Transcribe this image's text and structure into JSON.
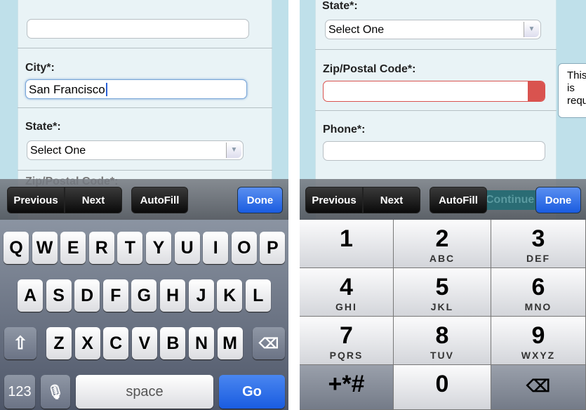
{
  "left": {
    "city_label": "City*:",
    "city_value": "San Francisco",
    "state_label": "State*:",
    "state_value": "Select One",
    "zip_label_partial": "Zip/Postal Code*:",
    "toolbar": {
      "previous": "Previous",
      "next": "Next",
      "autofill": "AutoFill",
      "done": "Done"
    },
    "keyboard": {
      "row1": [
        "Q",
        "W",
        "E",
        "R",
        "T",
        "Y",
        "U",
        "I",
        "O",
        "P"
      ],
      "row2": [
        "A",
        "S",
        "D",
        "F",
        "G",
        "H",
        "J",
        "K",
        "L"
      ],
      "row3": [
        "Z",
        "X",
        "C",
        "V",
        "B",
        "N",
        "M"
      ],
      "numbers": "123",
      "space": "space",
      "go": "Go"
    }
  },
  "right": {
    "state_label": "State*:",
    "state_value": "Select One",
    "zip_label": "Zip/Postal Code*:",
    "tooltip": "This is requ",
    "phone_label": "Phone*:",
    "continue_partial": "Continue",
    "toolbar": {
      "previous": "Previous",
      "next": "Next",
      "autofill": "AutoFill",
      "done": "Done"
    },
    "keypad": [
      {
        "n": "1",
        "l": ""
      },
      {
        "n": "2",
        "l": "ABC"
      },
      {
        "n": "3",
        "l": "DEF"
      },
      {
        "n": "4",
        "l": "GHI"
      },
      {
        "n": "5",
        "l": "JKL"
      },
      {
        "n": "6",
        "l": "MNO"
      },
      {
        "n": "7",
        "l": "PQRS"
      },
      {
        "n": "8",
        "l": "TUV"
      },
      {
        "n": "9",
        "l": "WXYZ"
      },
      {
        "n": "+*#",
        "l": ""
      },
      {
        "n": "0",
        "l": ""
      }
    ],
    "error_color": "#d9534f"
  },
  "colors": {
    "accent": "#1a5ce0",
    "error": "#d9534f"
  }
}
